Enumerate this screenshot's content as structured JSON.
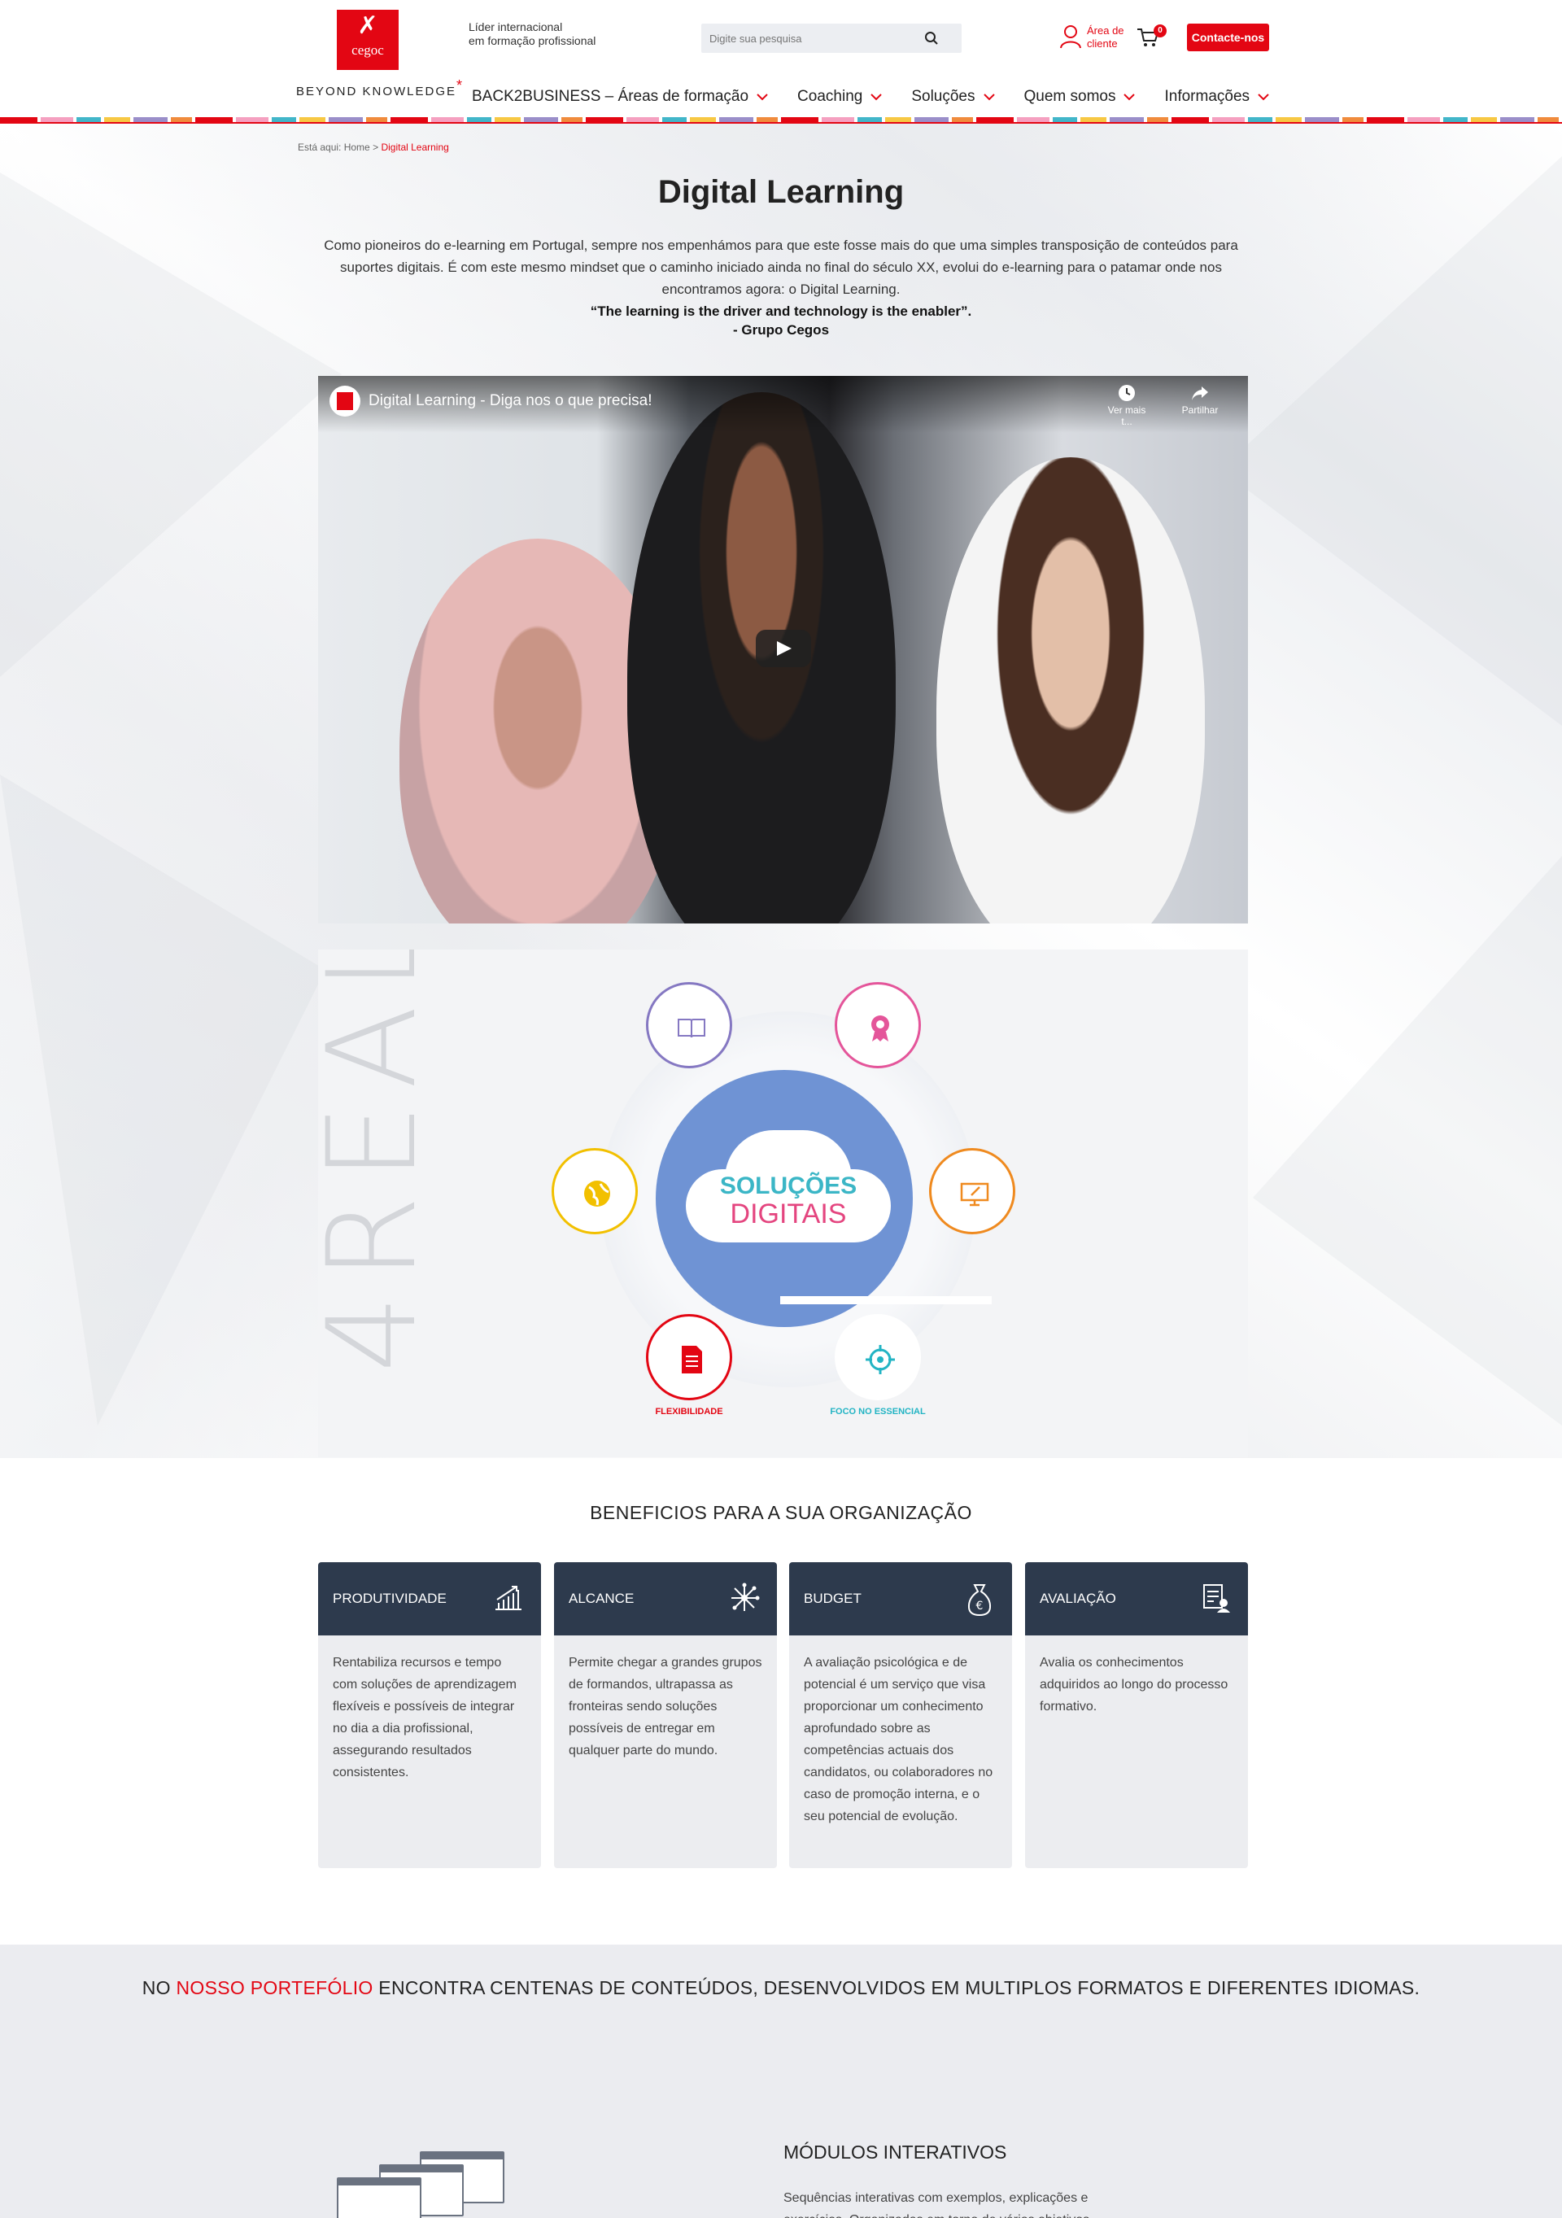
{
  "brand": {
    "logo_word": "cegoc",
    "tagline_line1": "Líder internacional",
    "tagline_line2": "em formação profissional",
    "beyond": "BEYOND KNOWLEDGE",
    "red": "#e30613",
    "navy": "#2d3a4d"
  },
  "search": {
    "placeholder": "Digite sua pesquisa",
    "icon": "search-icon"
  },
  "client_area": {
    "line1": "Área de",
    "line2": "cliente",
    "icon": "user-icon"
  },
  "cart": {
    "count": "0",
    "icon": "cart-icon"
  },
  "contact_button": "Contacte-nos",
  "nav": [
    {
      "label": "BACK2BUSINESS – Áreas de formação"
    },
    {
      "label": "Coaching"
    },
    {
      "label": "Soluções"
    },
    {
      "label": "Quem somos"
    },
    {
      "label": "Informações"
    }
  ],
  "breadcrumb": {
    "prefix": "Está aqui:",
    "home": "Home",
    "sep": ">",
    "current": "Digital Learning"
  },
  "page": {
    "title": "Digital Learning",
    "intro": "Como pioneiros do e-learning em Portugal, sempre nos empenhámos para que este fosse mais do que uma simples transposição de conteúdos para suportes digitais. É com este mesmo mindset que o caminho iniciado ainda no final do século XX, evolui do e-learning para o patamar onde nos encontramos agora: o Digital Learning.",
    "quote": "“The learning is the driver and technology is the enabler”.",
    "quote_by": "- Grupo Cegos"
  },
  "video": {
    "title": "Digital Learning - Diga nos o que precisa!",
    "watch_later": "Ver mais t...",
    "share": "Partilhar"
  },
  "infographic": {
    "side_text": "4REAL",
    "center_line1": "SOLUÇÕES",
    "center_line2": "DIGITAIS",
    "label_flex": "FLEXIBILIDADE",
    "label_focus": "FOCO NO ESSENCIAL"
  },
  "benefits": {
    "title": "BENEFICIOS PARA A SUA ORGANIZAÇÃO",
    "cards": [
      {
        "title": "PRODUTIVIDADE",
        "icon": "chart-growth-icon",
        "text": "Rentabiliza recursos e tempo com soluções de aprendizagem flexíveis e possíveis de integrar no dia a dia profissional, assegurando resultados consistentes."
      },
      {
        "title": "ALCANCE",
        "icon": "network-icon",
        "text": "Permite chegar a grandes grupos de formandos, ultrapassa as fronteiras sendo soluções possíveis de entregar em qualquer parte do mundo."
      },
      {
        "title": "BUDGET",
        "icon": "money-bag-icon",
        "text": "A avaliação psicológica e de potencial é um serviço que visa proporcionar um conhecimento aprofundado sobre as competências actuais dos candidatos, ou colaboradores no caso de promoção interna, e o seu potencial de evolução."
      },
      {
        "title": "AVALIAÇÃO",
        "icon": "evaluation-icon",
        "text": "Avalia os conhecimentos adquiridos ao longo do processo formativo."
      }
    ]
  },
  "portfolio": {
    "pre": "NO ",
    "highlight": "NOSSO PORTEFÓLIO",
    "post": " ENCONTRA CENTENAS DE CONTEÚDOS, DESENVOLVIDOS EM MULTIPLOS FORMATOS E DIFERENTES IDIOMAS.",
    "module_title": "MÓDULOS INTERATIVOS",
    "module_text": "Sequências interativas com exemplos, explicações e exercícios. Organizadas em torno de vários objetivos"
  }
}
